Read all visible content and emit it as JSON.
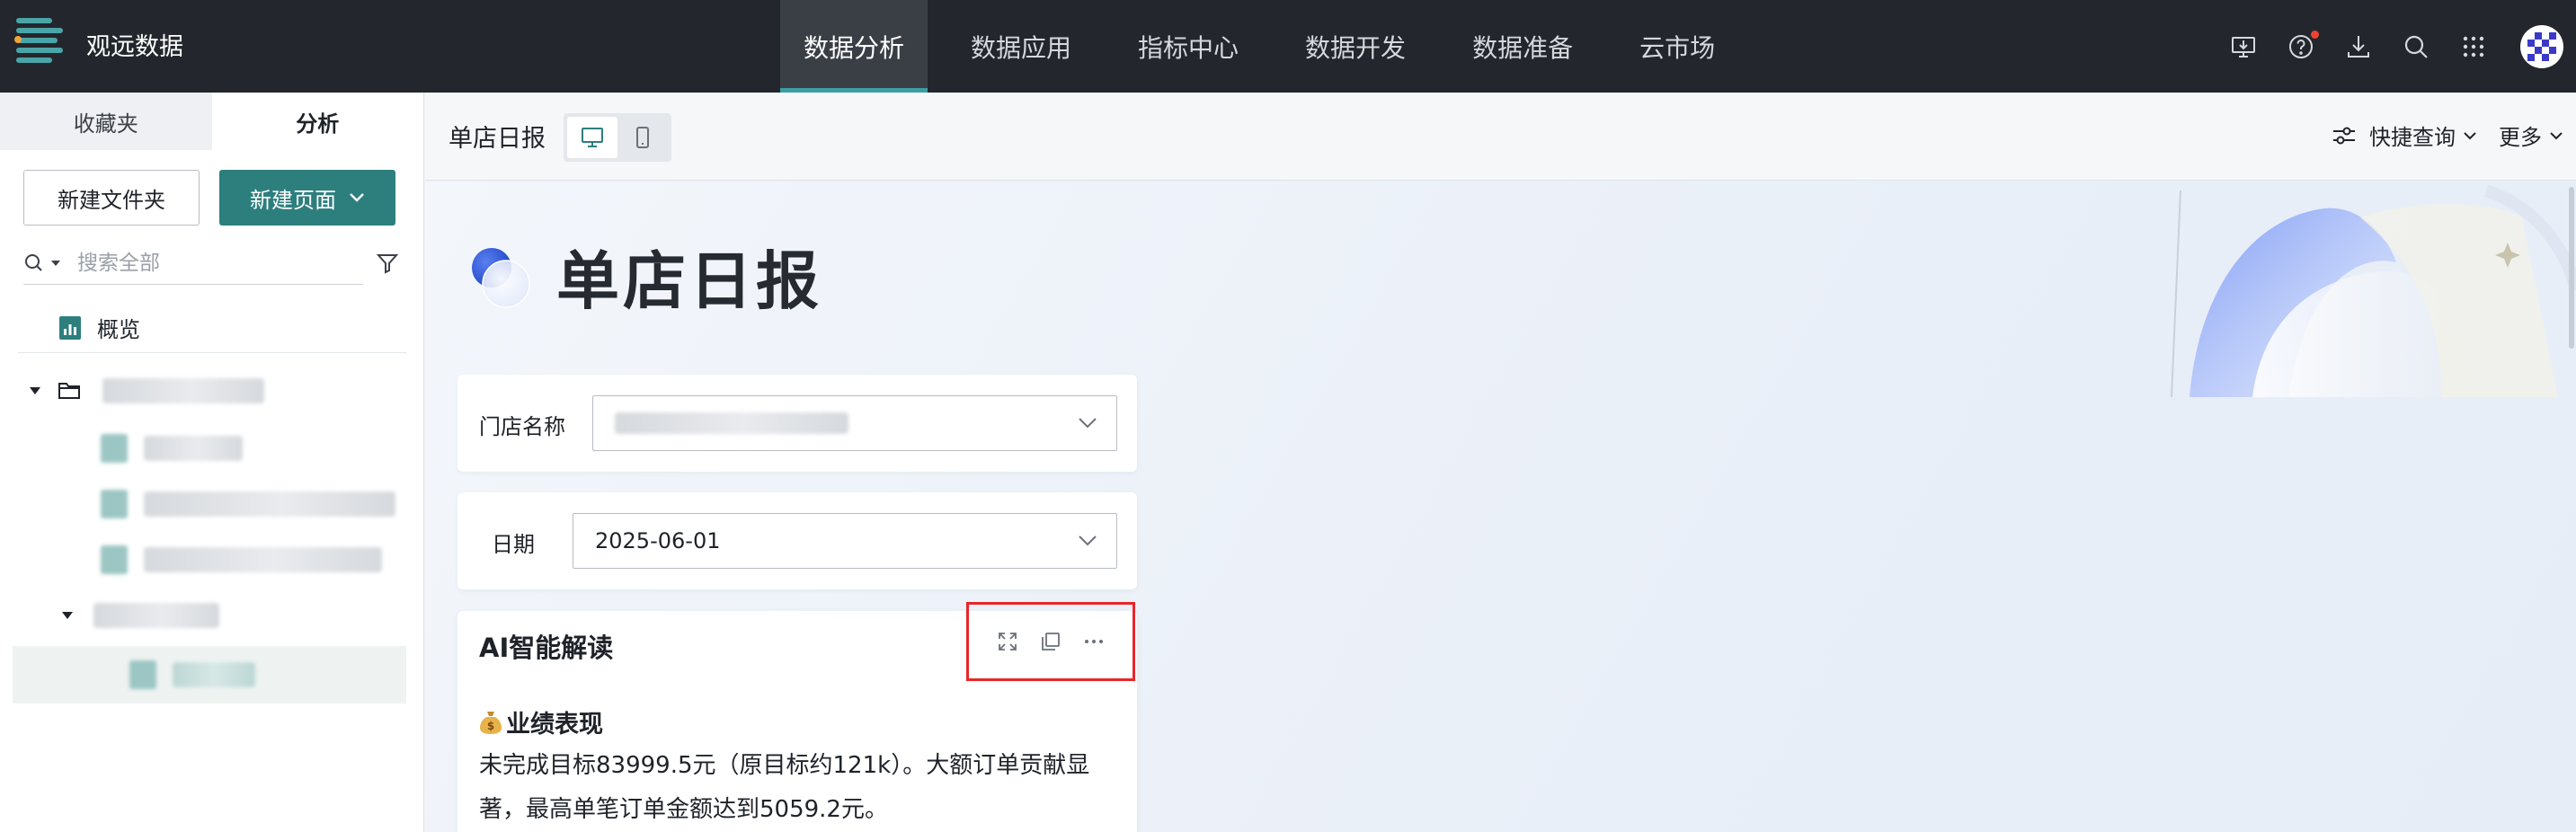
{
  "app": {
    "brand": "观远数据",
    "nav": [
      "数据分析",
      "数据应用",
      "指标中心",
      "数据开发",
      "数据准备",
      "云市场"
    ],
    "active_nav": "数据分析",
    "icons": [
      "screen-download-icon",
      "help-icon",
      "download-icon",
      "search-icon",
      "apps-grid-icon",
      "avatar"
    ],
    "colors": {
      "topbar": "#23272d",
      "accent": "#2d7f7e",
      "highlight": "#e8262a"
    }
  },
  "sidebar": {
    "tabs": [
      "收藏夹",
      "分析"
    ],
    "active_tab": "分析",
    "new_folder": "新建文件夹",
    "new_page": "新建页面",
    "search_placeholder": "搜索全部",
    "overview": "概览"
  },
  "page": {
    "name": "单店日报",
    "title": "单店日报",
    "quick_query": "快捷查询",
    "more": "更多",
    "filters": {
      "store_label": "门店名称",
      "date_label": "日期",
      "date_value": "2025-06-01"
    },
    "ai_card": {
      "title": "AI智能解读",
      "section": "业绩表现",
      "text": "未完成目标83999.5元（原目标约121k）。大额订单贡献显著，最高单笔订单金额达到5059.2元。"
    }
  }
}
